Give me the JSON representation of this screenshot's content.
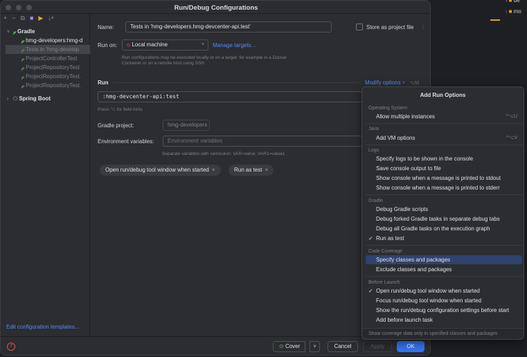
{
  "window": {
    "title": "Run/Debug Configurations"
  },
  "left_panel": {
    "toolbar": [
      "+",
      "−",
      "⧉",
      "■",
      "▶",
      "↓ᵃ"
    ],
    "tree": [
      {
        "label": "Gradle",
        "level": 0,
        "expanded": true,
        "bold": true
      },
      {
        "label": "hmg-developers:hmg-d",
        "level": 1
      },
      {
        "label": "Tests in 'hmg-develop",
        "level": 1,
        "selected": true
      },
      {
        "label": "ProjectControllerTest",
        "level": 1
      },
      {
        "label": "ProjectRepositoryTest",
        "level": 1
      },
      {
        "label": "ProjectRepositoryTest.",
        "level": 1
      },
      {
        "label": "ProjectRepositoryTest.",
        "level": 1
      },
      {
        "label": "Spring Boot",
        "level": 0,
        "expanded": false,
        "bold": true
      }
    ],
    "edit_templates": "Edit configuration templates..."
  },
  "form": {
    "name_label": "Name:",
    "name_value": "Tests in 'hmg-developers.hmg-devcenter-api.test'",
    "store_label": "Store as project file",
    "run_on_label": "Run on:",
    "run_on_value": "Local machine",
    "manage_targets": "Manage targets...",
    "run_on_hint": "Run configurations may be executed locally or on a target: for example in a Docker Container or on a remote host using SSH.",
    "run_section": "Run",
    "modify_options": "Modify options",
    "modify_shortcut": "⌥M",
    "tasks_value": ":hmg-devcenter-api:test",
    "field_hint": "Press ⌥ for field hints",
    "gradle_project_label": "Gradle project:",
    "gradle_project_value": "hmg-developers",
    "env_label": "Environment variables:",
    "env_placeholder": "Environment variables",
    "env_hint": "Separate variables with semicolon: VAR=value; VAR1=value1",
    "chips": [
      "Open run/debug tool window when started",
      "Run as test"
    ]
  },
  "bottom": {
    "help": "?",
    "cover": "Cover",
    "cancel": "Cancel",
    "apply": "Apply",
    "ok": "OK"
  },
  "popup": {
    "title": "Add Run Options",
    "groups": [
      {
        "name": "Operating System",
        "items": [
          {
            "label": "Allow multiple instances",
            "shortcut": "^⌥U"
          }
        ]
      },
      {
        "name": "Java",
        "items": [
          {
            "label": "Add VM options",
            "shortcut": "^⌥V"
          }
        ]
      },
      {
        "name": "Logs",
        "items": [
          {
            "label": "Specify logs to be shown in the console"
          },
          {
            "label": "Save console output to file"
          },
          {
            "label": "Show console when a message is printed to stdout"
          },
          {
            "label": "Show console when a message is printed to stderr"
          }
        ]
      },
      {
        "name": "Gradle",
        "items": [
          {
            "label": "Debug Gradle scripts"
          },
          {
            "label": "Debug forked Gradle tasks in separate debug tabs"
          },
          {
            "label": "Debug all Gradle tasks on the execution graph"
          },
          {
            "label": "Run as test",
            "checked": true
          }
        ]
      },
      {
        "name": "Code Coverage",
        "items": [
          {
            "label": "Specify classes and packages",
            "highlighted": true
          },
          {
            "label": "Exclude classes and packages"
          }
        ]
      },
      {
        "name": "Before Launch",
        "items": [
          {
            "label": "Open run/debug tool window when started",
            "checked": true
          },
          {
            "label": "Focus run/debug tool window when started"
          },
          {
            "label": "Show the run/debug configuration settings before start"
          },
          {
            "label": "Add before launch task"
          }
        ]
      }
    ],
    "footer": "Show coverage data only in specified classes and packages"
  },
  "background": {
    "items": [
      "de",
      "mo"
    ]
  },
  "colors": {
    "accent": "#3574f0",
    "link": "#548af7",
    "gradle": "#5fb857",
    "highlight": "#2e436e"
  }
}
